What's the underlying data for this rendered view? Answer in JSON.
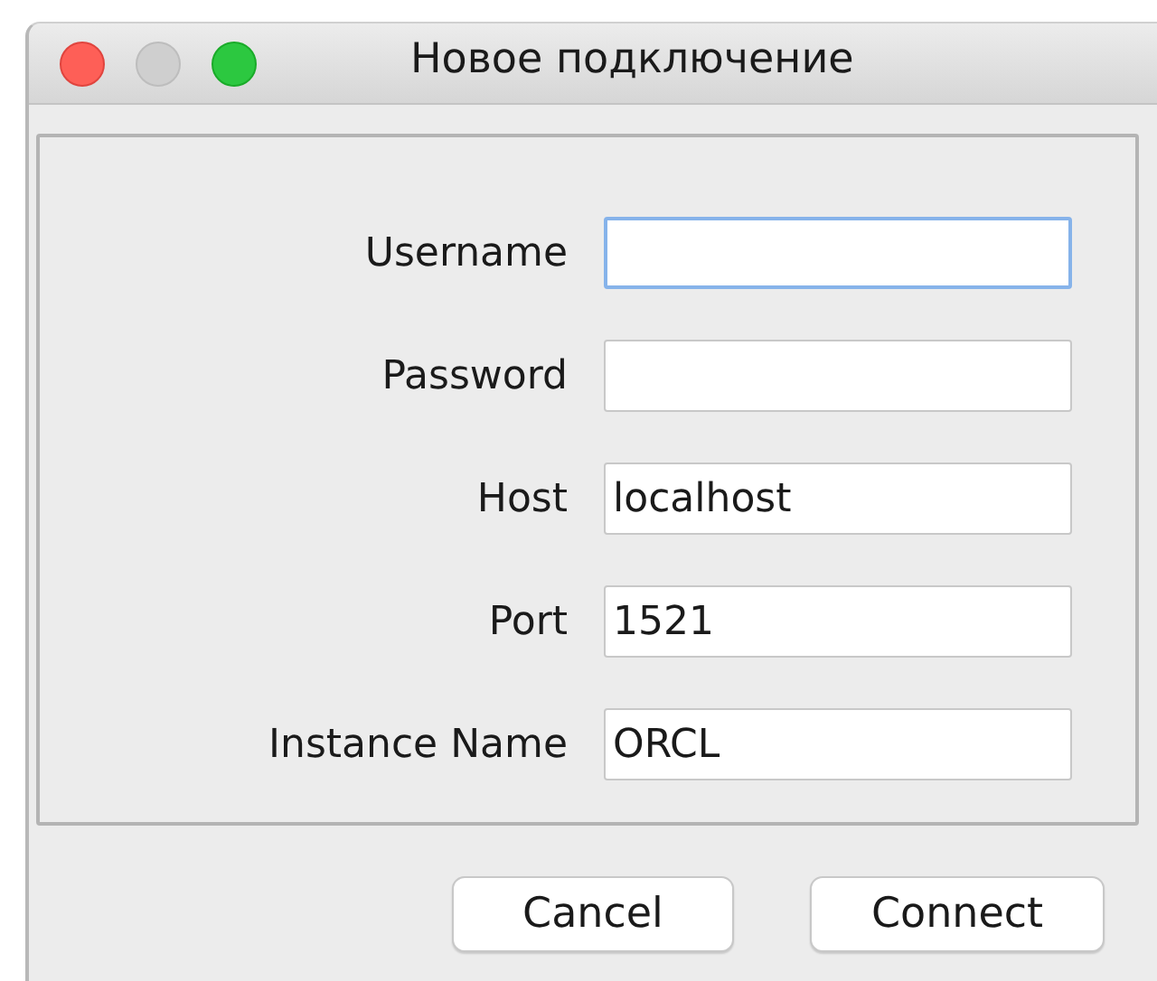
{
  "window": {
    "title": "Новое подключение"
  },
  "fields": [
    {
      "label": "Username",
      "focused": true
    },
    {
      "label": "Password",
      "focused": false
    },
    {
      "label": "Host",
      "value": "localhost",
      "focused": false
    },
    {
      "label": "Port",
      "value": "1521",
      "focused": false
    },
    {
      "label": "Instance Name",
      "value": "ORCL",
      "focused": false
    }
  ],
  "buttons": [
    "Cancel",
    "Connect"
  ]
}
